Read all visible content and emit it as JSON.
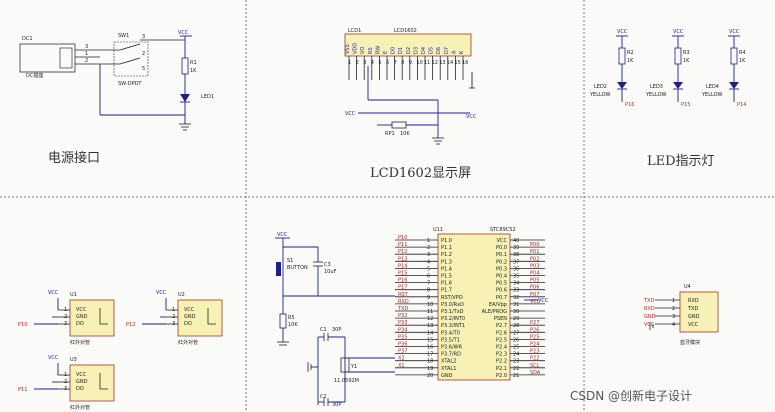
{
  "labels": {
    "power": "电源接口",
    "lcd": "LCD1602显示屏",
    "led": "LED指示灯",
    "watermark": "CSDN @创新电子设计"
  },
  "power": {
    "dc": "DC1",
    "sw": "SW1",
    "sw_name": "SW-DPDT",
    "r": "R1",
    "r_val": "1K",
    "led": "LED1",
    "dc_name": "DC插座",
    "vcc": "VCC"
  },
  "lcd": {
    "ref": "LCD1",
    "part": "LCD1602",
    "pins": [
      "VSS",
      "VDD",
      "VO",
      "RS",
      "RW",
      "E",
      "D0",
      "D1",
      "D2",
      "D3",
      "D4",
      "D5",
      "D6",
      "D7",
      "A",
      "K"
    ],
    "rp": "RP1",
    "rp_val": "10K",
    "vcc": "VCC"
  },
  "leds": {
    "items": [
      {
        "r": "R2",
        "val": "1K",
        "led": "LED2",
        "color": "YELLOW",
        "net": "P16"
      },
      {
        "r": "R3",
        "val": "1K",
        "led": "LED3",
        "color": "YELLOW",
        "net": "P15"
      },
      {
        "r": "R4",
        "val": "1K",
        "led": "LED4",
        "color": "YELLOW",
        "net": "P14"
      }
    ],
    "vcc": "VCC"
  },
  "sensors": {
    "items": [
      {
        "ref": "U1",
        "net": "P10",
        "name": "红外对管"
      },
      {
        "ref": "U2",
        "net": "P12",
        "name": "红外对管"
      },
      {
        "ref": "U3",
        "net": "P11",
        "name": "红外对管"
      }
    ],
    "pins": [
      "VCC",
      "GND",
      "DO"
    ]
  },
  "mcu": {
    "ref": "U11",
    "part": "STC89C52",
    "button": "BUTTON",
    "c3": "C3",
    "c3_val": "10uF",
    "r5": "R5",
    "r5_val": "10K",
    "c1": "C1",
    "c2": "C2",
    "cap_val": "30P",
    "xtal": "Y1",
    "xtal_val": "11.0592M",
    "left_pins": [
      "P1.0",
      "P1.1",
      "P1.2",
      "P1.3",
      "P1.4",
      "P1.5",
      "P1.6",
      "P1.7",
      "RST/VPD",
      "P3.0/RxD",
      "P3.1/TxD",
      "P3.2/INT0",
      "P3.3/INT1",
      "P3.4/T0",
      "P3.5/T1",
      "P3.6/WR",
      "P3.7/RD",
      "XTAL2",
      "XTAL1",
      "GND"
    ],
    "left_nums": [
      "1",
      "2",
      "3",
      "4",
      "5",
      "6",
      "7",
      "8",
      "9",
      "10",
      "11",
      "12",
      "13",
      "14",
      "15",
      "16",
      "17",
      "18",
      "19",
      "20"
    ],
    "left_nets": [
      "P10",
      "P11",
      "P12",
      "P13",
      "P14",
      "P15",
      "P16",
      "P17",
      "RST",
      "RXD",
      "TXD",
      "P32",
      "P33",
      "P34",
      "P35",
      "P36",
      "P37",
      "X2",
      "X1",
      ""
    ],
    "right_pins": [
      "VCC",
      "P0.0",
      "P0.1",
      "P0.2",
      "P0.3",
      "P0.4",
      "P0.5",
      "P0.6",
      "P0.7",
      "EA/Vpp",
      "ALE/PROG",
      "PSEN",
      "P2.7",
      "P2.6",
      "P2.5",
      "P2.4",
      "P2.3",
      "P2.2",
      "P2.1",
      "P2.0"
    ],
    "right_nums": [
      "40",
      "39",
      "38",
      "37",
      "36",
      "35",
      "34",
      "33",
      "32",
      "31",
      "30",
      "29",
      "28",
      "27",
      "26",
      "25",
      "24",
      "23",
      "22",
      "21"
    ],
    "right_nets": [
      "",
      "P00",
      "P01",
      "P02",
      "P03",
      "P04",
      "P05",
      "P06",
      "P07",
      "VCC",
      "",
      "",
      "P27",
      "P26",
      "P25",
      "P24",
      "P23",
      "P22",
      "SCL",
      "SDA"
    ]
  },
  "bt": {
    "ref": "U4",
    "pins": [
      "RXD",
      "TXD",
      "GND",
      "VCC"
    ],
    "nets": [
      "TXD",
      "RXD",
      "GND",
      "VCC"
    ],
    "name": "蓝牙模块"
  }
}
